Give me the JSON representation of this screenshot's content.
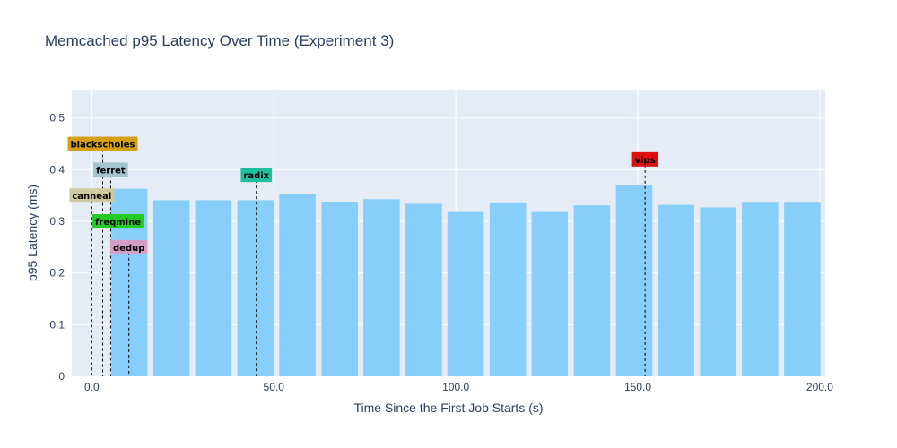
{
  "chart_data": {
    "type": "bar",
    "title": "Memcached p95 Latency Over Time (Experiment 3)",
    "xlabel": "Time Since the First Job Starts (s)",
    "ylabel": "p95 Latency (ms)",
    "xlim": [
      -5.5,
      201.5
    ],
    "ylim": [
      0,
      0.555
    ],
    "xticks": [
      0,
      50,
      100,
      150,
      200
    ],
    "xtick_labels": [
      "0.0",
      "50.0",
      "100.0",
      "150.0",
      "200.0"
    ],
    "yticks": [
      0,
      0.1,
      0.2,
      0.3,
      0.4,
      0.5
    ],
    "ytick_labels": [
      "0",
      "0.1",
      "0.2",
      "0.3",
      "0.4",
      "0.5"
    ],
    "grid": true,
    "bar_color": "#87cefa",
    "plot_bg": "#e5ecf6",
    "bars": [
      {
        "x": 10.3,
        "value": 0.363
      },
      {
        "x": 21.9,
        "value": 0.341
      },
      {
        "x": 33.4,
        "value": 0.341
      },
      {
        "x": 45.0,
        "value": 0.341
      },
      {
        "x": 56.5,
        "value": 0.352
      },
      {
        "x": 68.1,
        "value": 0.337
      },
      {
        "x": 79.6,
        "value": 0.343
      },
      {
        "x": 91.2,
        "value": 0.334
      },
      {
        "x": 102.7,
        "value": 0.318
      },
      {
        "x": 114.3,
        "value": 0.335
      },
      {
        "x": 125.8,
        "value": 0.318
      },
      {
        "x": 137.4,
        "value": 0.331
      },
      {
        "x": 149.0,
        "value": 0.37
      },
      {
        "x": 160.5,
        "value": 0.332
      },
      {
        "x": 172.1,
        "value": 0.327
      },
      {
        "x": 183.6,
        "value": 0.336
      },
      {
        "x": 195.2,
        "value": 0.336
      }
    ],
    "bar_width": 10.0,
    "annotations": [
      {
        "name": "blackscholes",
        "x": 3.0,
        "y": 0.45,
        "color": "#d4a017"
      },
      {
        "name": "ferret",
        "x": 5.2,
        "y": 0.4,
        "color": "#a3c4cf"
      },
      {
        "name": "canneal",
        "x": 0.0,
        "y": 0.35,
        "color": "#cfcaa1"
      },
      {
        "name": "freqmine",
        "x": 7.2,
        "y": 0.3,
        "color": "#22cc22"
      },
      {
        "name": "dedup",
        "x": 10.2,
        "y": 0.25,
        "color": "#d4a0c8"
      },
      {
        "name": "radix",
        "x": 45.2,
        "y": 0.39,
        "color": "#1fbf9f"
      },
      {
        "name": "vips",
        "x": 152.0,
        "y": 0.42,
        "color": "#dd1111"
      }
    ]
  }
}
